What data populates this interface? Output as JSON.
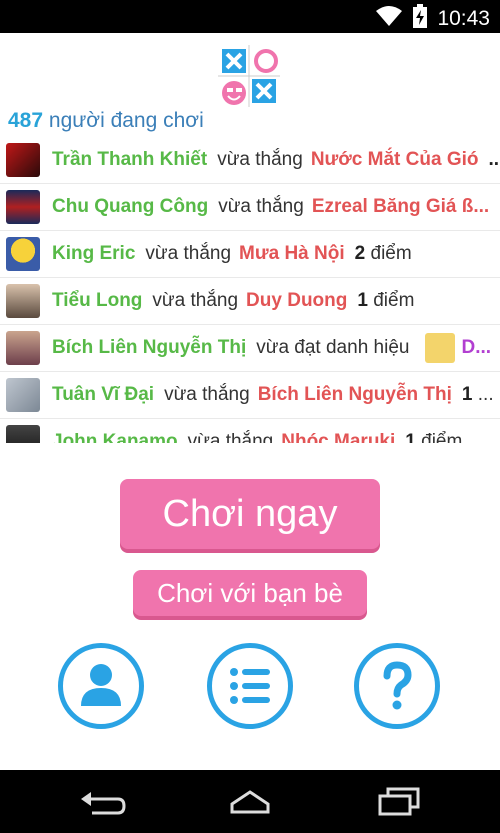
{
  "status_bar": {
    "time": "10:43",
    "icons": [
      "wifi-icon",
      "battery-charging-icon"
    ]
  },
  "online": {
    "count": "487",
    "label": "người đang chơi"
  },
  "feed": [
    {
      "winner": "Trần Thanh Khiết",
      "verb": "vừa thắng",
      "loser": "Nước Mắt Của Gió",
      "points": "...",
      "points_label": ""
    },
    {
      "winner": "Chu Quang Công",
      "verb": "vừa thắng",
      "loser": "Ezreal Băng Giá ß...",
      "points": "",
      "points_label": ""
    },
    {
      "winner": "King Eric",
      "verb": "vừa thắng",
      "loser": "Mưa Hà Nội",
      "points": "2",
      "points_label": "điểm"
    },
    {
      "winner": "Tiểu Long",
      "verb": "vừa thắng",
      "loser": "Duy Duong",
      "points": "1",
      "points_label": "điểm"
    },
    {
      "winner": "Bích Liên Nguyễn Thị",
      "verb": "vừa đạt danh hiệu",
      "title": "D..."
    },
    {
      "winner": "Tuân Vĩ Đại",
      "verb": "vừa thắng",
      "loser": "Bích Liên Nguyễn Thị",
      "points": "1",
      "points_label": "..."
    },
    {
      "winner": "John Kanamo",
      "verb": "vừa thắng",
      "loser": "Nhóc Maruki",
      "points": "1",
      "points_label": "điểm"
    }
  ],
  "buttons": {
    "play_now": "Chơi ngay",
    "play_friends": "Chơi với bạn bè"
  },
  "colors": {
    "accent_blue": "#2aa3e4",
    "pink_button": "#f074ad",
    "winner_green": "#57b947",
    "loser_red": "#e25455"
  }
}
